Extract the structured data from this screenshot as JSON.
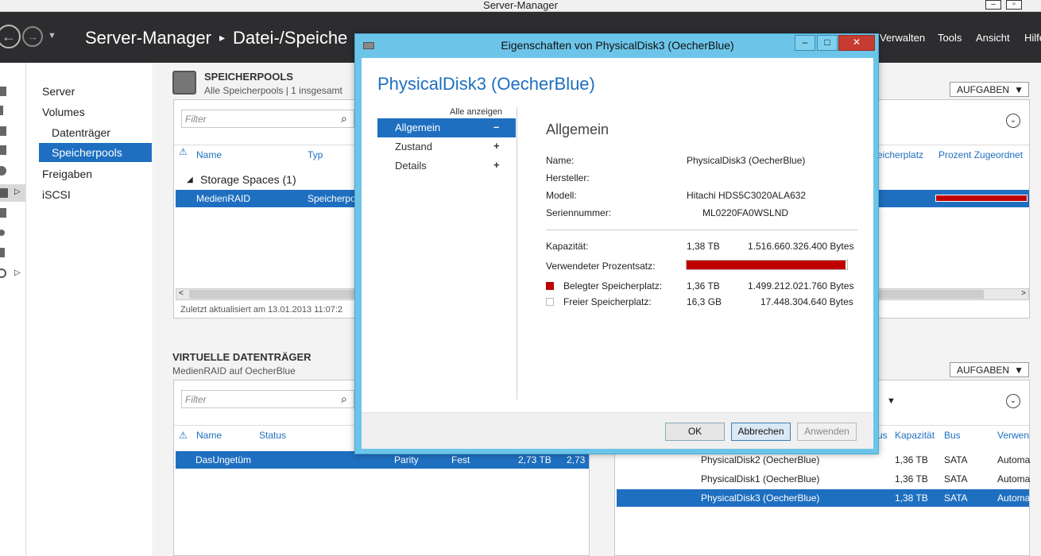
{
  "window": {
    "title": "Server-Manager"
  },
  "header": {
    "breadcrumb_root": "Server-Manager",
    "breadcrumb_current": "Datei-/Speiche",
    "menu": [
      "Verwalten",
      "Tools",
      "Ansicht",
      "Hilfe"
    ]
  },
  "nav": {
    "items": [
      "Server",
      "Volumes",
      "Datenträger",
      "Speicherpools",
      "Freigaben",
      "iSCSI"
    ]
  },
  "pools": {
    "title": "SPEICHERPOOLS",
    "subtitle": "Alle Speicherpools | 1 insgesamt",
    "filter_placeholder": "Filter",
    "columns": [
      "Name",
      "Typ"
    ],
    "right_columns": [
      "eicherplatz",
      "Prozent Zugeordnet"
    ],
    "group": "Storage Spaces (1)",
    "row": {
      "name": "MedienRAID",
      "type": "Speicherpo"
    },
    "updated": "Zuletzt aktualisiert am 13.01.2013 11:07:2",
    "tasks": "AUFGABEN"
  },
  "vdisks": {
    "title": "VIRTUELLE DATENTRÄGER",
    "subtitle": "MedienRAID auf OecherBlue",
    "filter_placeholder": "Filter",
    "columns": [
      "Name",
      "Status"
    ],
    "row": {
      "name": "DasUngetüm",
      "layout": "Parity",
      "prov": "Fest",
      "cap": "2,73 TB",
      "cap2": "2,73"
    },
    "tasks": "AUFGABEN"
  },
  "pdisks": {
    "columns": [
      "us",
      "Kapazität",
      "Bus",
      "Verwen"
    ],
    "rows": [
      {
        "name": "PhysicalDisk2 (OecherBlue)",
        "cap": "1,36 TB",
        "bus": "SATA",
        "use": "Automa"
      },
      {
        "name": "PhysicalDisk1 (OecherBlue)",
        "cap": "1,36 TB",
        "bus": "SATA",
        "use": "Automa"
      },
      {
        "name": "PhysicalDisk3 (OecherBlue)",
        "cap": "1,38 TB",
        "bus": "SATA",
        "use": "Automa"
      }
    ]
  },
  "dialog": {
    "title": "Eigenschaften von PhysicalDisk3 (OecherBlue)",
    "heading": "PhysicalDisk3 (OecherBlue)",
    "show_all": "Alle anzeigen",
    "pane": [
      {
        "label": "Allgemein",
        "sign": "–"
      },
      {
        "label": "Zustand",
        "sign": "+"
      },
      {
        "label": "Details",
        "sign": "+"
      }
    ],
    "section": "Allgemein",
    "props": {
      "name_label": "Name:",
      "name": "PhysicalDisk3 (OecherBlue)",
      "vendor_label": "Hersteller:",
      "model_label": "Modell:",
      "model": "Hitachi HDS5C3020ALA632",
      "serial_label": "Seriennummer:",
      "serial": "ML0220FA0WSLND",
      "capacity_label": "Kapazität:",
      "capacity": "1,38 TB",
      "capacity_bytes": "1.516.660.326.400 Bytes",
      "used_pct_label": "Verwendeter Prozentsatz:",
      "used_label": "Belegter Speicherplatz:",
      "used": "1,36 TB",
      "used_bytes": "1.499.212.021.760 Bytes",
      "free_label": "Freier Speicherplatz:",
      "free": "16,3 GB",
      "free_bytes": "17.448.304.640 Bytes"
    },
    "used_fraction": 0.988,
    "buttons": {
      "ok": "OK",
      "cancel": "Abbrechen",
      "apply": "Anwenden"
    }
  },
  "colors": {
    "accent": "#1e6fc0",
    "used": "#c00000",
    "dialog_frame": "#6cc5e9",
    "close": "#c73c32"
  }
}
